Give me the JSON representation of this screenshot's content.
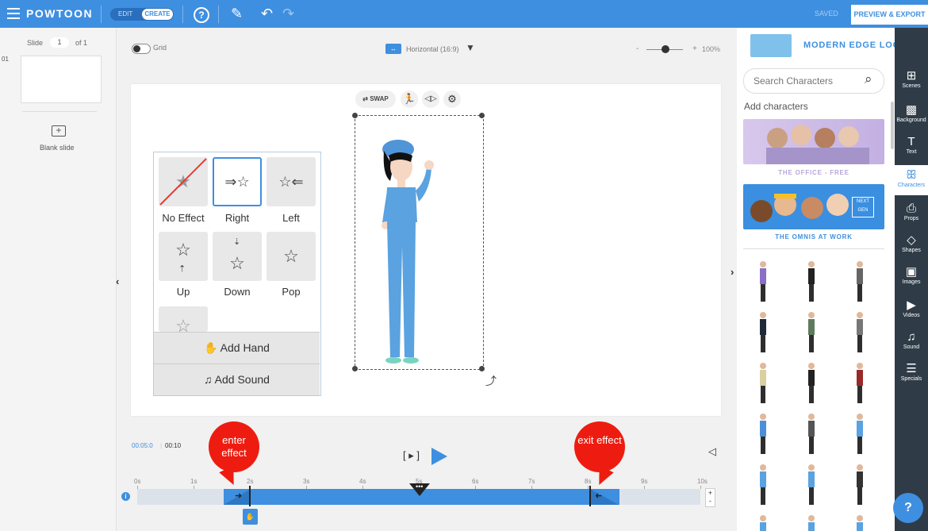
{
  "topbar": {
    "logo": "POWTOON",
    "mode_edit": "EDIT",
    "mode_create": "CREATE",
    "saved": "SAVED",
    "preview_export": "PREVIEW & EXPORT",
    "accent_color": "#3e8fe0"
  },
  "slides": {
    "label": "Slide",
    "current": "1",
    "of_label": "of 1",
    "items": [
      {
        "index": "01"
      }
    ],
    "blank_slide_label": "Blank slide"
  },
  "stage": {
    "grid_label": "Grid",
    "orientation_label": "Horizontal (16:9)",
    "zoom_minus": "-",
    "zoom_plus": "+",
    "zoom_value": "100%"
  },
  "element_toolbar": {
    "swap_label": "SWAP"
  },
  "effects": {
    "items": [
      {
        "label": "No Effect",
        "glyph": "★",
        "selected": false
      },
      {
        "label": "Right",
        "glyph": "⇒☆",
        "selected": true
      },
      {
        "label": "Left",
        "glyph": "☆⇐",
        "selected": false
      },
      {
        "label": "Up",
        "glyph": "☆",
        "selected": false
      },
      {
        "label": "Down",
        "glyph": "☆",
        "selected": false
      },
      {
        "label": "Pop",
        "glyph": "☆",
        "selected": false
      }
    ],
    "add_hand": "Add Hand",
    "add_sound": "Add Sound"
  },
  "timeline": {
    "current_time": "00:05:0",
    "total_time": "00:10",
    "ticks": [
      "0s",
      "1s",
      "2s",
      "3s",
      "4s",
      "5s",
      "6s",
      "7s",
      "8s",
      "9s",
      "10s"
    ],
    "enter_effect": "enter effect",
    "exit_effect": "exit effect",
    "enter_time_s": 2,
    "exit_time_s": 8,
    "playhead_time_s": 5,
    "zoom_plus": "+",
    "zoom_minus": "-"
  },
  "library": {
    "look_label": "MODERN EDGE LOOK",
    "search_placeholder": "Search Characters",
    "add_characters_label": "Add characters",
    "packs": [
      {
        "name": "THE OFFICE - FREE",
        "name_color": "#b9a6d9"
      },
      {
        "name": "THE OMNIS AT WORK",
        "name_color": "#3e8fe0",
        "badge": "NEXT GEN"
      }
    ]
  },
  "sidebar": {
    "items": [
      {
        "label": "Scenes",
        "glyph": "⊞"
      },
      {
        "label": "Background",
        "glyph": "▩"
      },
      {
        "label": "Text",
        "glyph": "T"
      },
      {
        "label": "Characters",
        "glyph": "ꕥ",
        "active": true
      },
      {
        "label": "Props",
        "glyph": "⎙"
      },
      {
        "label": "Shapes",
        "glyph": "◇"
      },
      {
        "label": "Images",
        "glyph": "▣"
      },
      {
        "label": "Videos",
        "glyph": "▶"
      },
      {
        "label": "Sound",
        "glyph": "♫"
      },
      {
        "label": "Specials",
        "glyph": "☰"
      }
    ],
    "help_label": "?"
  }
}
